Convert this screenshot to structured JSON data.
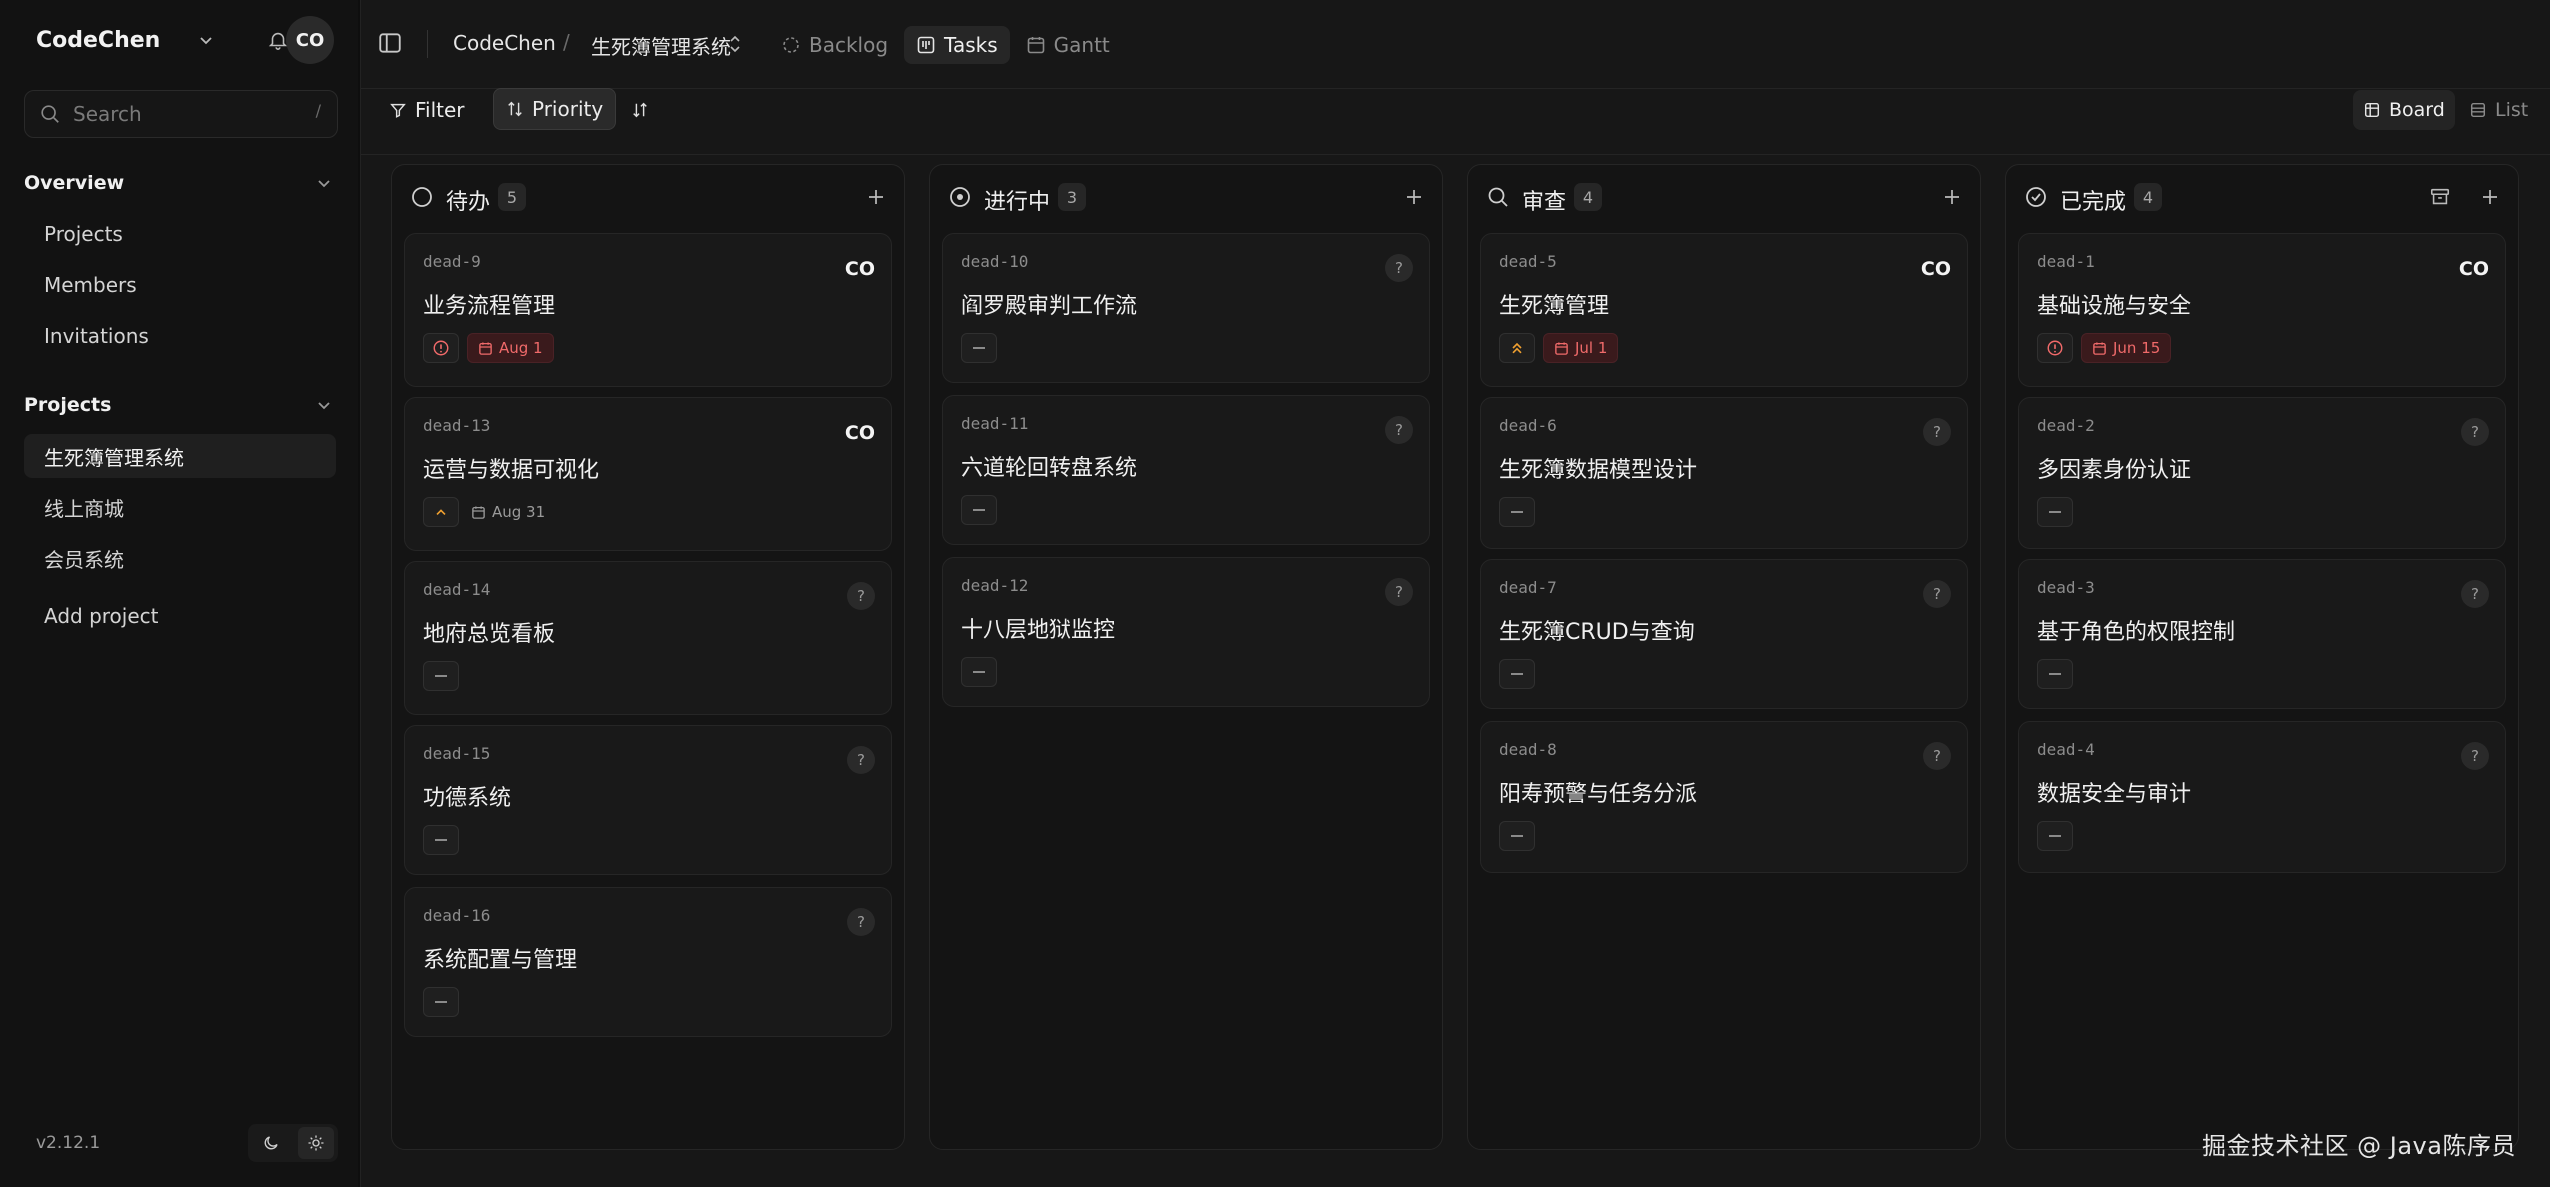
{
  "workspace": {
    "name": "CodeChen",
    "avatar": "CO"
  },
  "search": {
    "placeholder": "Search",
    "shortcut": "/"
  },
  "sidebar": {
    "overview": {
      "title": "Overview",
      "items": [
        "Projects",
        "Members",
        "Invitations"
      ]
    },
    "projects": {
      "title": "Projects",
      "items": [
        "生死簿管理系统",
        "线上商城",
        "会员系统"
      ],
      "add": "Add project"
    },
    "version": "v2.12.1"
  },
  "topbar": {
    "breadcrumb": [
      "CodeChen",
      "生死簿管理系统"
    ],
    "separator": "/",
    "tabs": [
      "Backlog",
      "Tasks",
      "Gantt"
    ],
    "active_tab": "Tasks"
  },
  "toolbar": {
    "filter": "Filter",
    "priority": "Priority",
    "board": "Board",
    "list": "List"
  },
  "columns": [
    {
      "title": "待办",
      "count": "5",
      "cards": [
        {
          "id": "dead-9",
          "title": "业务流程管理",
          "assignee": "CO",
          "priority": "urgent",
          "date": "Aug 1",
          "date_style": "overdue"
        },
        {
          "id": "dead-13",
          "title": "运营与数据可视化",
          "assignee": "CO",
          "priority": "medium",
          "date": "Aug 31",
          "date_style": "normal"
        },
        {
          "id": "dead-14",
          "title": "地府总览看板",
          "assignee": "?",
          "priority": "none"
        },
        {
          "id": "dead-15",
          "title": "功德系统",
          "assignee": "?",
          "priority": "none"
        },
        {
          "id": "dead-16",
          "title": "系统配置与管理",
          "assignee": "?",
          "priority": "none"
        }
      ]
    },
    {
      "title": "进行中",
      "count": "3",
      "cards": [
        {
          "id": "dead-10",
          "title": "阎罗殿审判工作流",
          "assignee": "?",
          "priority": "none"
        },
        {
          "id": "dead-11",
          "title": "六道轮回转盘系统",
          "assignee": "?",
          "priority": "none"
        },
        {
          "id": "dead-12",
          "title": "十八层地狱监控",
          "assignee": "?",
          "priority": "none"
        }
      ]
    },
    {
      "title": "审查",
      "count": "4",
      "cards": [
        {
          "id": "dead-5",
          "title": "生死簿管理",
          "assignee": "CO",
          "priority": "high",
          "date": "Jul 1",
          "date_style": "overdue"
        },
        {
          "id": "dead-6",
          "title": "生死簿数据模型设计",
          "assignee": "?",
          "priority": "none"
        },
        {
          "id": "dead-7",
          "title": "生死簿CRUD与查询",
          "assignee": "?",
          "priority": "none"
        },
        {
          "id": "dead-8",
          "title": "阳寿预警与任务分派",
          "assignee": "?",
          "priority": "none"
        }
      ]
    },
    {
      "title": "已完成",
      "count": "4",
      "cards": [
        {
          "id": "dead-1",
          "title": "基础设施与安全",
          "assignee": "CO",
          "priority": "urgent",
          "date": "Jun 15",
          "date_style": "overdue"
        },
        {
          "id": "dead-2",
          "title": "多因素身份认证",
          "assignee": "?",
          "priority": "none"
        },
        {
          "id": "dead-3",
          "title": "基于角色的权限控制",
          "assignee": "?",
          "priority": "none"
        },
        {
          "id": "dead-4",
          "title": "数据安全与审计",
          "assignee": "?",
          "priority": "none"
        }
      ]
    }
  ],
  "watermark": "掘金技术社区 @ Java陈序员",
  "colors": {
    "accent_red": "#f06a6a",
    "priority_orange": "#f0a030",
    "bg": "#0e0e0e"
  }
}
